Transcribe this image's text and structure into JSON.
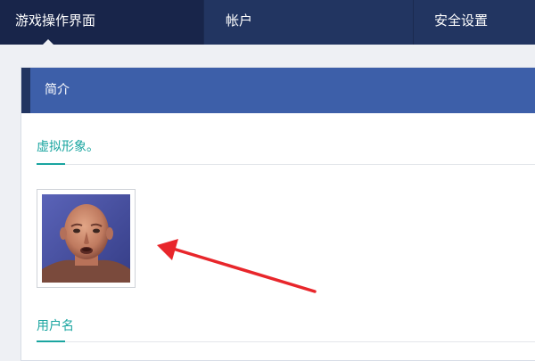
{
  "nav": {
    "items": [
      {
        "label": "游戏操作界面",
        "active": true
      },
      {
        "label": "帐户",
        "active": false
      },
      {
        "label": "安全设置",
        "active": false
      }
    ]
  },
  "panel": {
    "title": "简介"
  },
  "sections": {
    "avatar_label": "虚拟形象。",
    "username_label": "用户名"
  },
  "avatar": {
    "icon": "user-portrait"
  },
  "annotation": {
    "arrow_color": "#e8262b"
  },
  "colors": {
    "nav_bg": "#223561",
    "nav_active_bg": "#18254a",
    "panel_header_bg": "#3d5fa9",
    "accent_teal": "#1aa5a0"
  }
}
